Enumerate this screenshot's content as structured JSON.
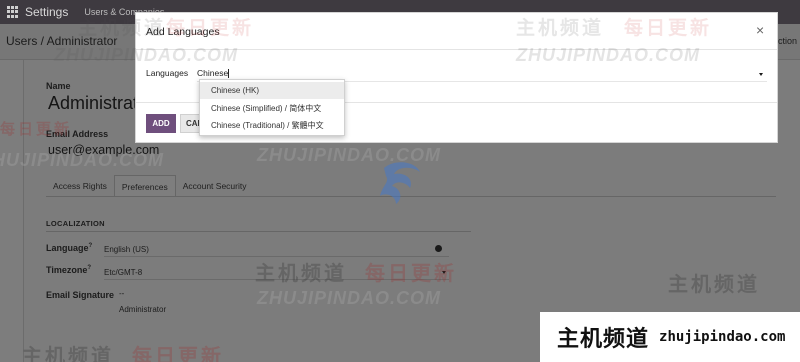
{
  "topbar": {
    "app_title": "Settings",
    "menu_users": "Users & Companies"
  },
  "control_panel": {
    "breadcrumb": "Users / Administrator",
    "right_action_text": "ction"
  },
  "form": {
    "name_label": "Name",
    "name_value": "Administrat",
    "email_label": "Email Address",
    "email_value": "user@example.com",
    "tabs": [
      {
        "label": "Access Rights",
        "active": false
      },
      {
        "label": "Preferences",
        "active": true
      },
      {
        "label": "Account Security",
        "active": false
      }
    ],
    "section_title": "LOCALIZATION",
    "language_label": "Language",
    "language_help": "?",
    "language_value": "English (US)",
    "timezone_label": "Timezone",
    "timezone_help": "?",
    "timezone_value": "Etc/GMT-8",
    "signature_label": "Email Signature",
    "signature_line1": "--",
    "signature_line2": "Administrator"
  },
  "modal": {
    "title": "Add Languages",
    "close_glyph": "×",
    "languages_label": "Languages",
    "languages_input_value": "Chinese",
    "add_button": "ADD",
    "cancel_button": "CANCEL",
    "dropdown_options": [
      {
        "label": "Chinese (HK)",
        "highlighted": true
      },
      {
        "label": "Chinese (Simplified) / 简体中文",
        "highlighted": false
      },
      {
        "label": "Chinese (Traditional) / 繁體中文",
        "highlighted": false
      }
    ]
  },
  "watermarks": {
    "cn_brand": "主机频道",
    "cn_daily": "每日更新",
    "en_url_upper": "ZHUJIPINDAO.COM",
    "badge_url": "zhujipindao.com"
  },
  "colors": {
    "topbar": "#3e3a40",
    "primary_button": "#6f4f7d",
    "dropdown_highlight": "#ececec",
    "overlay_background": "#7d7d7d"
  }
}
